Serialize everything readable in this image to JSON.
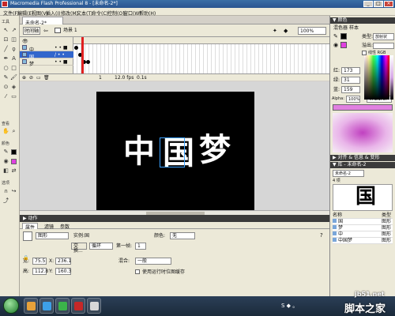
{
  "window": {
    "title": "Macromedia Flash Professional 8 - [未命名-2*]",
    "min": "_",
    "max": "□",
    "close": "×"
  },
  "menu": [
    "文件(F)",
    "编辑(E)",
    "视图(V)",
    "插入(I)",
    "修改(M)",
    "文本(T)",
    "命令(C)",
    "控制(O)",
    "窗口(W)",
    "帮助(H)"
  ],
  "toolbox": {
    "title": "工具",
    "view_label": "查看",
    "color_label": "颜色",
    "options_label": "选项"
  },
  "document": {
    "tab": "未命名-2*",
    "back_button": "时间轴",
    "scene": "场景 1",
    "zoom": "100%"
  },
  "timeline": {
    "layers": [
      {
        "name": "中",
        "dots": "• • ■",
        "active": false
      },
      {
        "name": "国",
        "dots": "/ • •",
        "active": true
      },
      {
        "name": "梦",
        "dots": "• • ■",
        "active": false
      }
    ],
    "status": {
      "frame": "1",
      "fps": "12.0 fps",
      "time": "0.1s"
    }
  },
  "stage": {
    "chars": [
      "中",
      "国",
      "梦"
    ]
  },
  "panels": {
    "actions": "▶ 动作",
    "props_tabs": [
      "属性",
      "滤镜",
      "参数"
    ],
    "props": {
      "type": "图形",
      "instance_label": "实例:",
      "instance_value": "国",
      "swap_button": "交换...",
      "loop_value": "循环",
      "first_label": "第一帧:",
      "first_value": "1",
      "color_label": "颜色:",
      "color_value": "无",
      "w_label": "宽:",
      "w_value": "75.5",
      "x_label": "X:",
      "x_value": "236.1",
      "h_label": "高:",
      "h_value": "112.8",
      "y_label": "Y:",
      "y_value": "160.3",
      "blend_label": "混合:",
      "blend_value": "一般",
      "cache_label": "使用运行时位图缓存"
    }
  },
  "right": {
    "color_panel": "▼ 颜色",
    "color_tabs": [
      "混色器",
      "样本"
    ],
    "type_label": "类型:",
    "type_value": "放射状",
    "overflow_label": "溢出:",
    "r_label": "红:",
    "r_value": "173",
    "g_label": "绿:",
    "g_value": "31",
    "b_label": "蓝:",
    "b_value": "159",
    "alpha_label": "Alpha:",
    "alpha_value": "100%",
    "hex_value": "#AD1F9F",
    "linear_label": "线性 RGB",
    "align_panel": "▶ 对齐 & 信息 & 变形",
    "library_panel": "▼ 库 - 未命名-2",
    "library_doc": "未命名-2",
    "library_count": "4 项",
    "library_cols": {
      "name": "名称",
      "type": "类型"
    },
    "library_items": [
      {
        "name": "国",
        "type": "图形"
      },
      {
        "name": "梦",
        "type": "图形"
      },
      {
        "name": "中",
        "type": "图形"
      },
      {
        "name": "中国梦",
        "type": "图形"
      }
    ]
  },
  "taskbar": {
    "tray": "S ◆ 。",
    "watermark_top": "jb51.net",
    "watermark_bottom": "脚本之家"
  }
}
